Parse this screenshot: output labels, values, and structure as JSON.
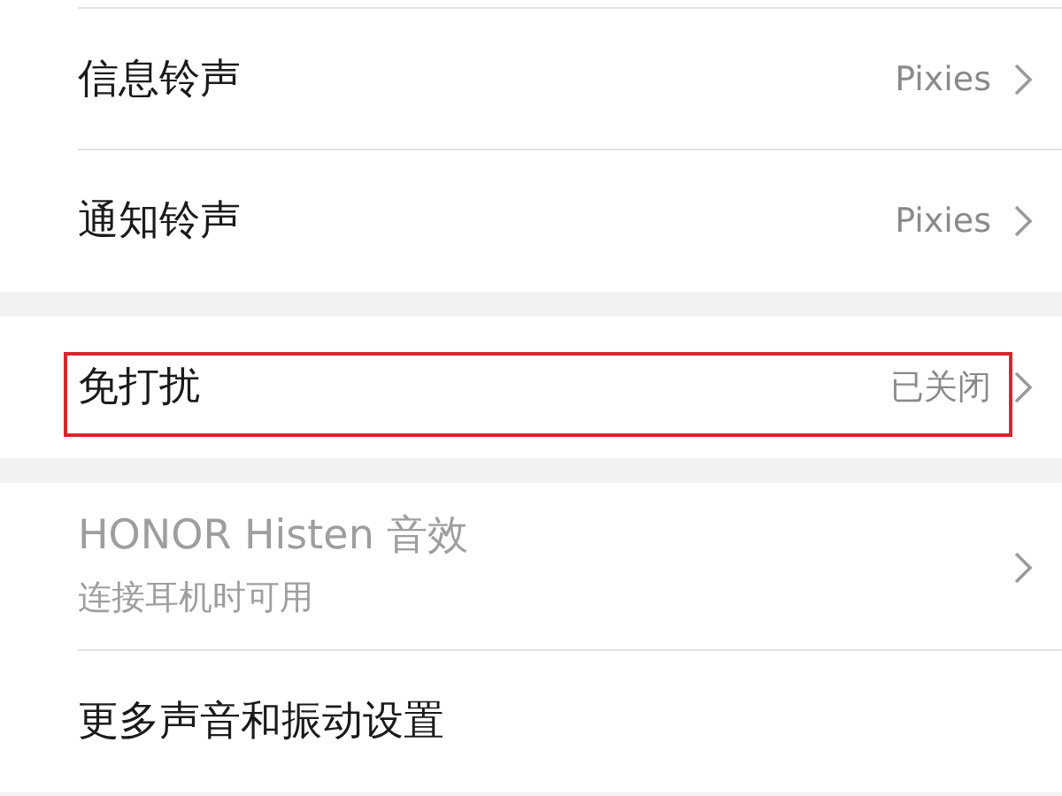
{
  "groups": [
    {
      "rows": [
        {
          "title": "信息铃声",
          "value": "Pixies",
          "disabled": false,
          "highlighted": false
        },
        {
          "title": "通知铃声",
          "value": "Pixies",
          "disabled": false,
          "highlighted": false
        }
      ]
    },
    {
      "rows": [
        {
          "title": "免打扰",
          "value": "已关闭",
          "disabled": false,
          "highlighted": true
        }
      ]
    },
    {
      "rows": [
        {
          "title": "HONOR Histen 音效",
          "subtitle": "连接耳机时可用",
          "disabled": true,
          "highlighted": false
        },
        {
          "title": "更多声音和振动设置",
          "disabled": false,
          "highlighted": false
        }
      ]
    }
  ]
}
